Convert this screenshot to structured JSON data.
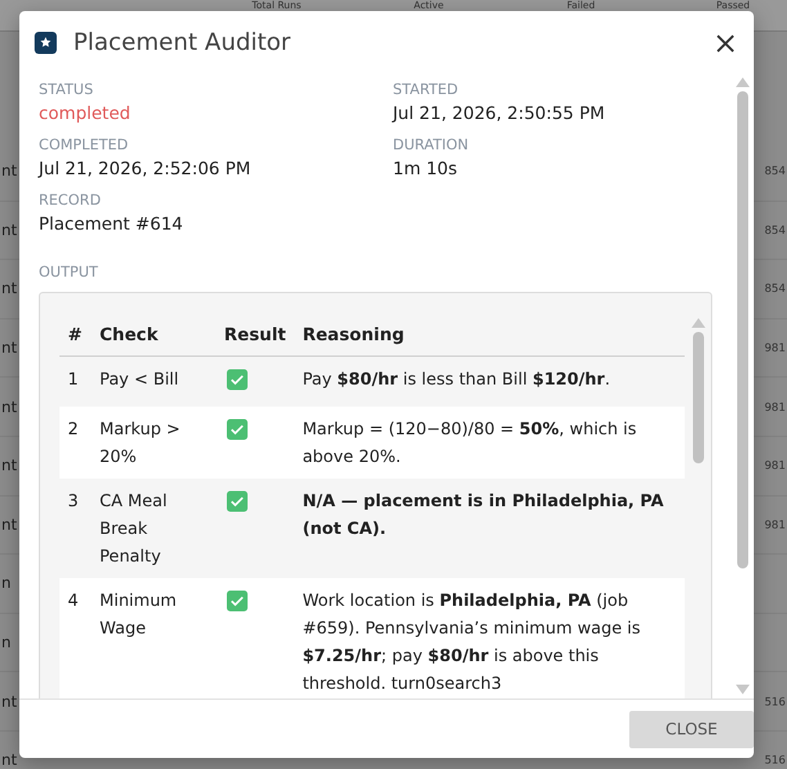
{
  "backdrop": {
    "columns": [
      "Total Runs",
      "Active",
      "Failed",
      "Passed"
    ],
    "rows": [
      {
        "column_1": "nt",
        "column_2": "854"
      },
      {
        "column_1": "nt",
        "column_2": "854"
      },
      {
        "column_1": "nt",
        "column_2": "854"
      },
      {
        "column_1": "nt",
        "column_2": "981"
      },
      {
        "column_1": "nt",
        "column_2": "981"
      },
      {
        "column_1": "nt",
        "column_2": "981"
      },
      {
        "column_1": "nt",
        "column_2": "981"
      },
      {
        "column_1": "n"
      },
      {
        "column_1": "n"
      },
      {
        "column_1": "nt",
        "column_2": "516"
      },
      {
        "column_1": "nt",
        "column_2": "516"
      }
    ]
  },
  "dialog": {
    "title": "Placement Auditor",
    "fields": [
      {
        "label": "STATUS",
        "value": "completed",
        "kind": "status"
      },
      {
        "label": "STARTED",
        "value": "Jul 21, 2026, 2:50:55 PM",
        "kind": "text"
      },
      {
        "label": "COMPLETED",
        "value": "Jul 21, 2026, 2:52:06 PM",
        "kind": "text"
      },
      {
        "label": "DURATION",
        "value": "1m 10s",
        "kind": "text"
      },
      {
        "label": "RECORD",
        "value": "Placement #614",
        "kind": "text"
      }
    ],
    "output": {
      "label": "OUTPUT",
      "columns": [
        "#",
        "Check",
        "Result",
        "Reasoning"
      ],
      "rows": [
        {
          "number": "1",
          "check": "Pay < Bill",
          "passed": true,
          "reasoning": "Pay **$80/hr** is less than Bill **$120/hr**."
        },
        {
          "number": "2",
          "check": "Markup > 20%",
          "passed": true,
          "reasoning": "Markup = (120−80)/80 = **50%**, which is above 20%."
        },
        {
          "number": "3",
          "check": "CA Meal Break Penalty",
          "passed": true,
          "reasoning": "**N/A — placement is in Philadelphia, PA (not CA).**"
        },
        {
          "number": "4",
          "check": "Minimum Wage",
          "passed": true,
          "reasoning": "Work location is **Philadelphia, PA** (job #659). Pennsylvania’s minimum wage is **$7.25/hr**; pay **$80/hr** is above this threshold. turn0search3"
        }
      ]
    },
    "close_button": "CLOSE"
  }
}
